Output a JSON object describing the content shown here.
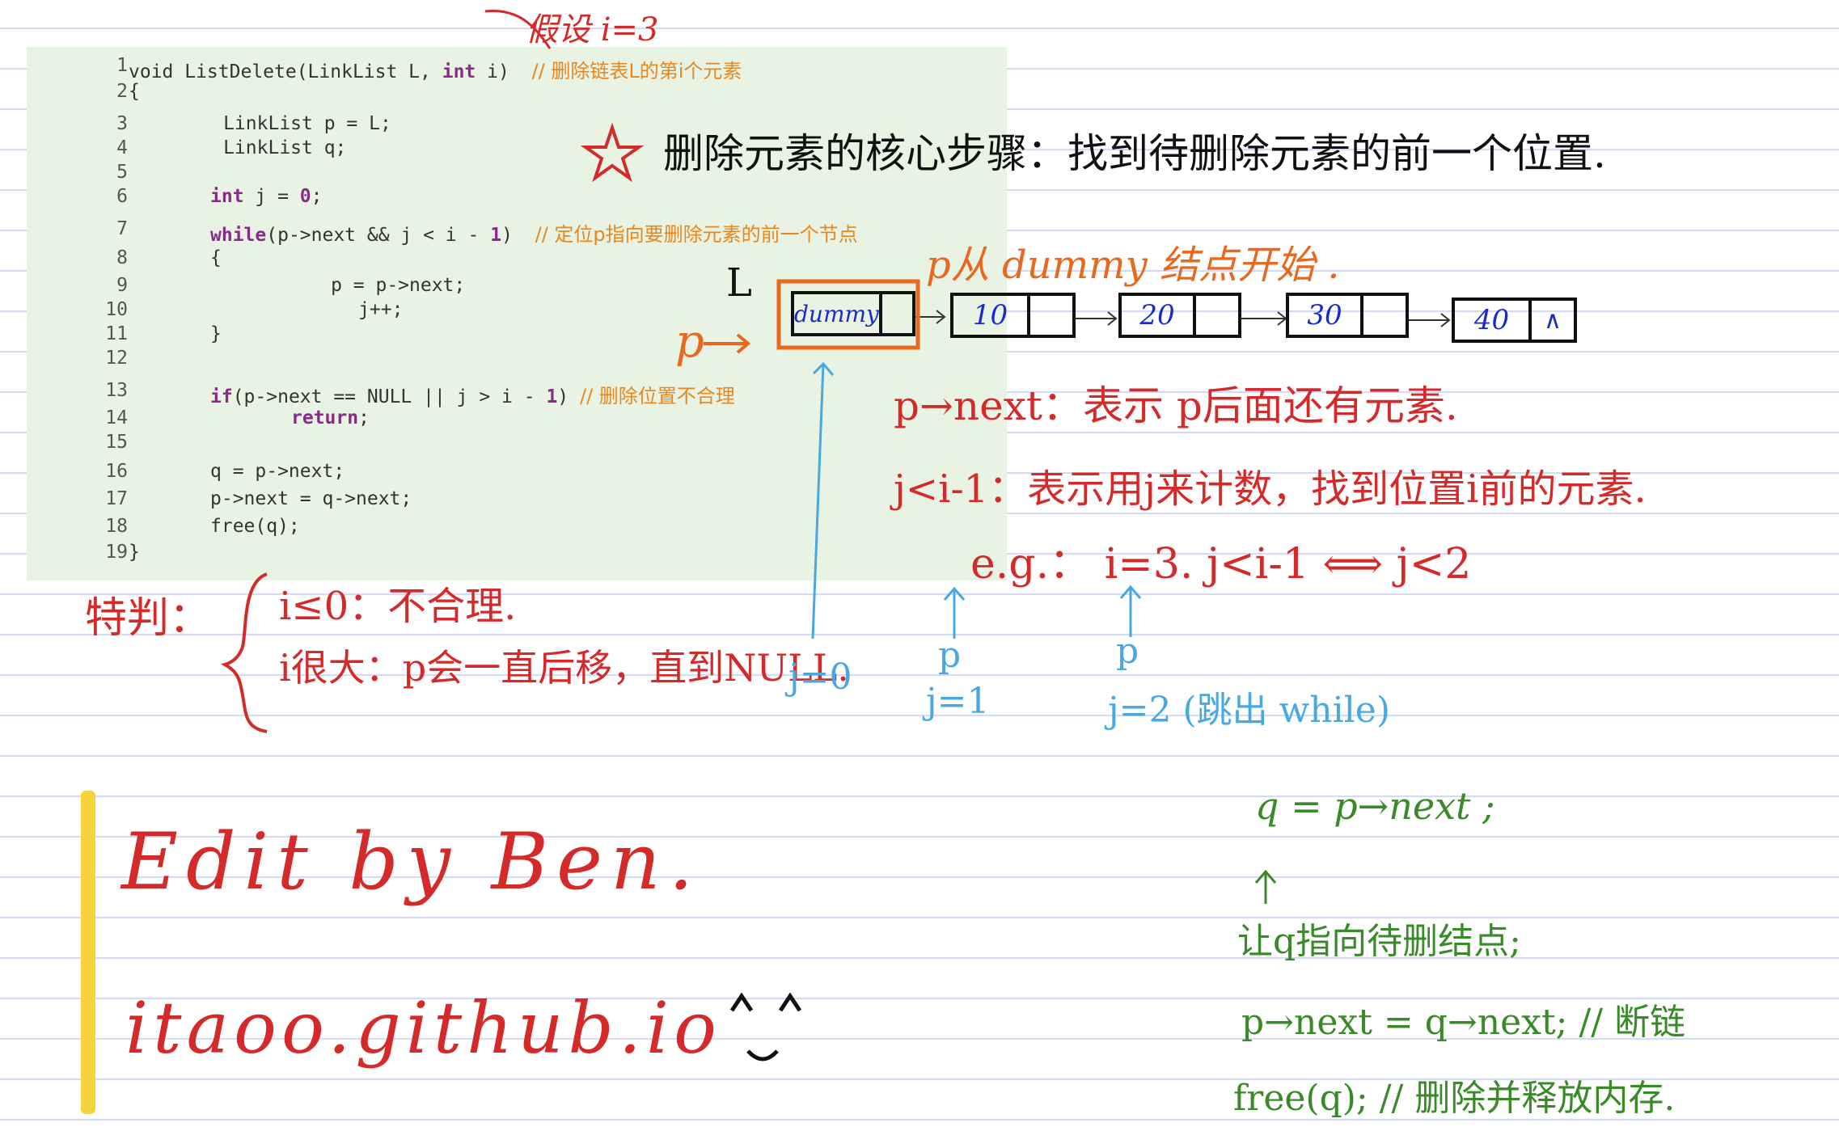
{
  "code": {
    "line_numbers": [
      "1",
      "2",
      "3",
      "4",
      "5",
      "6",
      "7",
      "8",
      "9",
      "10",
      "11",
      "12",
      "13",
      "14",
      "15",
      "16",
      "17",
      "18",
      "19"
    ],
    "l1_kw": "void",
    "l1_text": " ListDelete(LinkList L, ",
    "l1_int": "int",
    "l1_text2": " i)  ",
    "l1_comment": "// 删除链表L的第i个元素",
    "l2": "{",
    "l3": "      LinkList p = L;",
    "l4": "      LinkList q;",
    "l6_kw": "int",
    "l6_text": " j = ",
    "l6_num": "0",
    "l6_end": ";",
    "l7_kw": "while",
    "l7_text": "(p->next && j < i - ",
    "l7_num": "1",
    "l7_end": ")  ",
    "l7_comment": "// 定位p指向要删除元素的前一个节点",
    "l8": "{",
    "l9": "      p = p->next;",
    "l10": "      j++;",
    "l11": "}",
    "l13_kw": "if",
    "l13_text": "(p->next == NULL || j > i - ",
    "l13_num": "1",
    "l13_end": ") ",
    "l13_comment": "// 删除位置不合理",
    "l14_kw": "return",
    "l14_end": ";",
    "l16": "q = p->next;",
    "l17": "p->next = q->next;",
    "l18": "free(q);",
    "l19": "}"
  },
  "notes": {
    "assume": "假设 i=3",
    "core": "删除元素的核心步骤：找到待删除元素的前一个位置.",
    "p_from_dummy": "p从 dummy 结点开始 .",
    "L_label": "L",
    "p_label": "p",
    "pnext_meaning": "p→next：表示 p后面还有元素.",
    "jlt_meaning": "j<i-1：表示用j来计数，找到位置i前的元素.",
    "eg": "e.g.： i=3.  j<i-1 ⟺ j<2",
    "judge": "特判：",
    "judge1": "i≤0：不合理.",
    "judge2": "i很大：p会一直后移，直到NULL.",
    "j0": "j=0",
    "p1": "p",
    "j1": "j=1",
    "p2": "p",
    "j2": "j=2 (跳出 while)",
    "q_assign": "q = p→next ;",
    "q_desc": "让q指向待删结点;",
    "relink": "p→next = q→next; // 断链",
    "free": "free(q); // 删除并释放内存.",
    "sig1": "Edit by Ben.",
    "sig2": "itaoo.github.io",
    "face": "^^"
  },
  "list": {
    "nodes": [
      "dummy",
      "10",
      "20",
      "30",
      "40"
    ],
    "null_symbol": "∧"
  },
  "colors": {
    "code_bg": "#e8f3e3",
    "comment": "#e8871e",
    "keyword": "#8a2a8a",
    "red_ink": "#d42a2a",
    "orange_ink": "#e8681e",
    "blue_ink": "#4aa8e0",
    "green_ink": "#3a8a2a",
    "navy_ink": "#1a2ad0",
    "yellow_bar": "#f6d33a"
  }
}
